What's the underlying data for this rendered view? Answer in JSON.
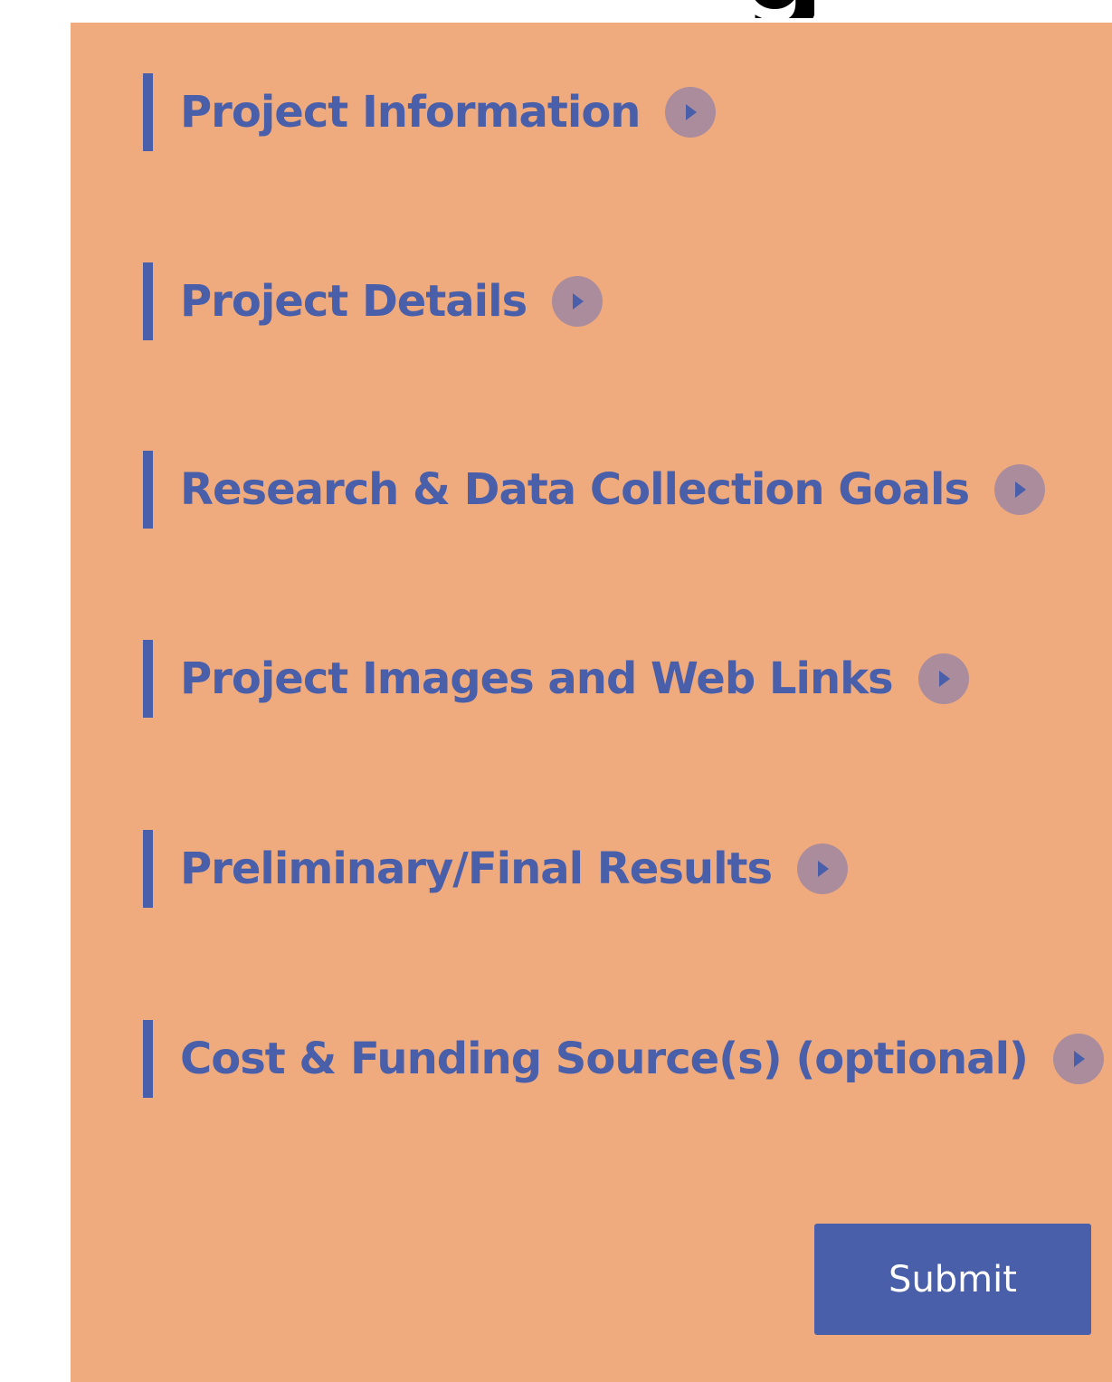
{
  "sections": [
    {
      "label": "Project Information",
      "icon": "chevron-right-circle-icon"
    },
    {
      "label": "Project Details",
      "icon": "chevron-right-circle-icon"
    },
    {
      "label": "Research & Data Collection Goals",
      "icon": "chevron-right-circle-icon"
    },
    {
      "label": "Project Images and Web Links",
      "icon": "chevron-right-circle-icon"
    },
    {
      "label": "Preliminary/Final Results",
      "icon": "chevron-right-circle-icon"
    },
    {
      "label": "Cost & Funding Source(s) (optional)",
      "icon": "chevron-right-circle-icon"
    }
  ],
  "form": {
    "submit_label": "Submit"
  },
  "colors": {
    "panel_background": "#efab7e",
    "accent": "#4a5fa9",
    "icon_circle": "#ab8c9c",
    "button_text": "#ffffff"
  }
}
